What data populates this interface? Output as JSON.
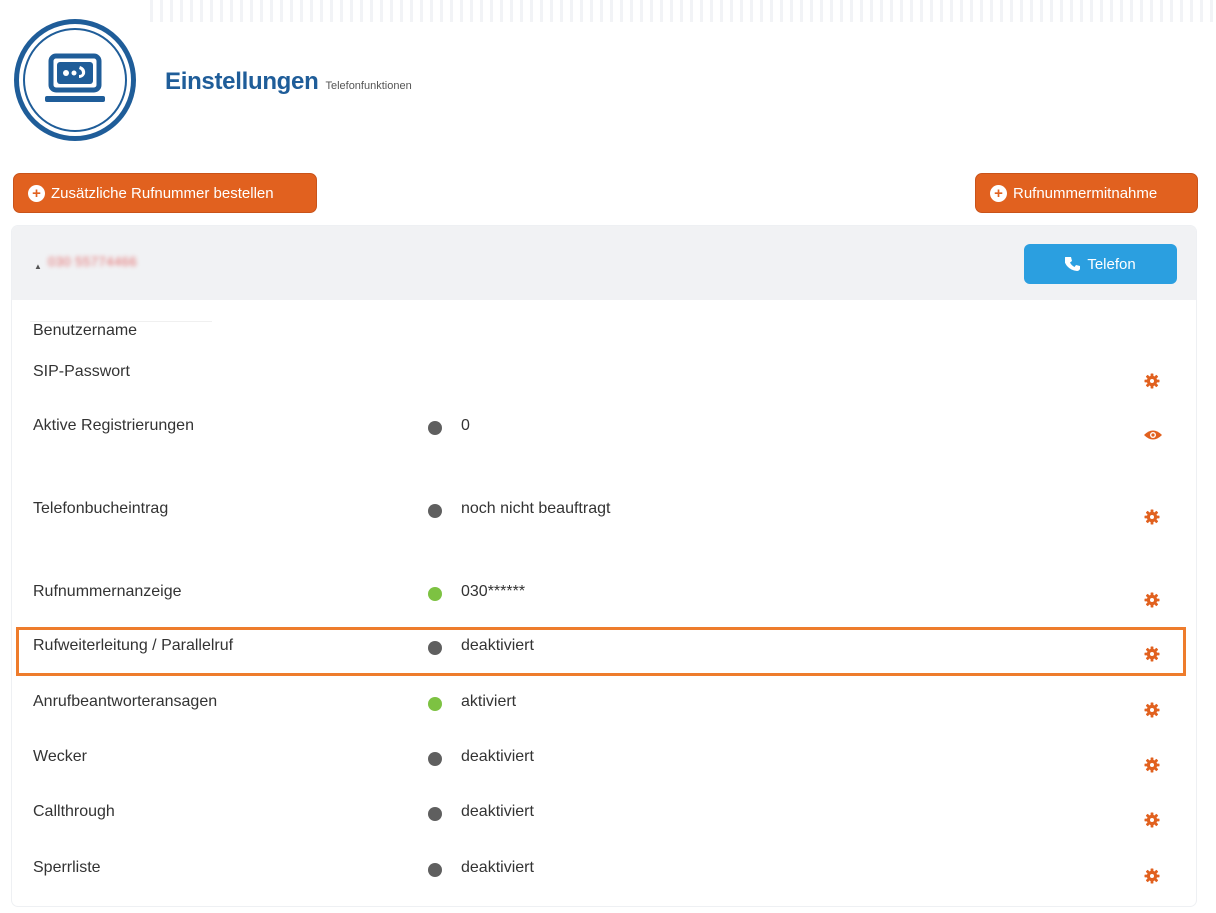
{
  "header": {
    "title": "Einstellungen",
    "subtitle": "Telefonfunktionen"
  },
  "buttons": {
    "add_number": "Zusätzliche Rufnummer bestellen",
    "porting": "Rufnummermitnahme",
    "telefon": "Telefon"
  },
  "panel": {
    "phone_number": "030 55774466"
  },
  "rows": [
    {
      "label": "Benutzername",
      "status": "",
      "dot": "",
      "action": ""
    },
    {
      "label": "SIP-Passwort",
      "status": "",
      "dot": "",
      "action": "gear-icon"
    },
    {
      "label": "Aktive Registrierungen",
      "status": "0",
      "dot": "gray",
      "action": "eye-icon"
    },
    {
      "label": "Telefonbucheintrag",
      "status": "noch nicht beauftragt",
      "dot": "gray",
      "action": "gear-icon"
    },
    {
      "label": "Rufnummernanzeige",
      "status": "030******",
      "dot": "green",
      "action": "gear-icon"
    },
    {
      "label": "Rufweiterleitung / Parallelruf",
      "status": "deaktiviert",
      "dot": "gray",
      "action": "gear-icon"
    },
    {
      "label": "Anrufbeantworteransagen",
      "status": "aktiviert",
      "dot": "green",
      "action": "gear-icon"
    },
    {
      "label": "Wecker",
      "status": "deaktiviert",
      "dot": "gray",
      "action": "gear-icon"
    },
    {
      "label": "Callthrough",
      "status": "deaktiviert",
      "dot": "gray",
      "action": "gear-icon"
    },
    {
      "label": "Sperrliste",
      "status": "deaktiviert",
      "dot": "gray",
      "action": "gear-icon"
    }
  ],
  "colors": {
    "brand_blue": "#1f5d99",
    "orange": "#e1611f",
    "button_blue": "#2b9fe0",
    "dot_gray": "#5f5f5f",
    "dot_green": "#7dc242",
    "highlight": "#ee7c2c"
  }
}
